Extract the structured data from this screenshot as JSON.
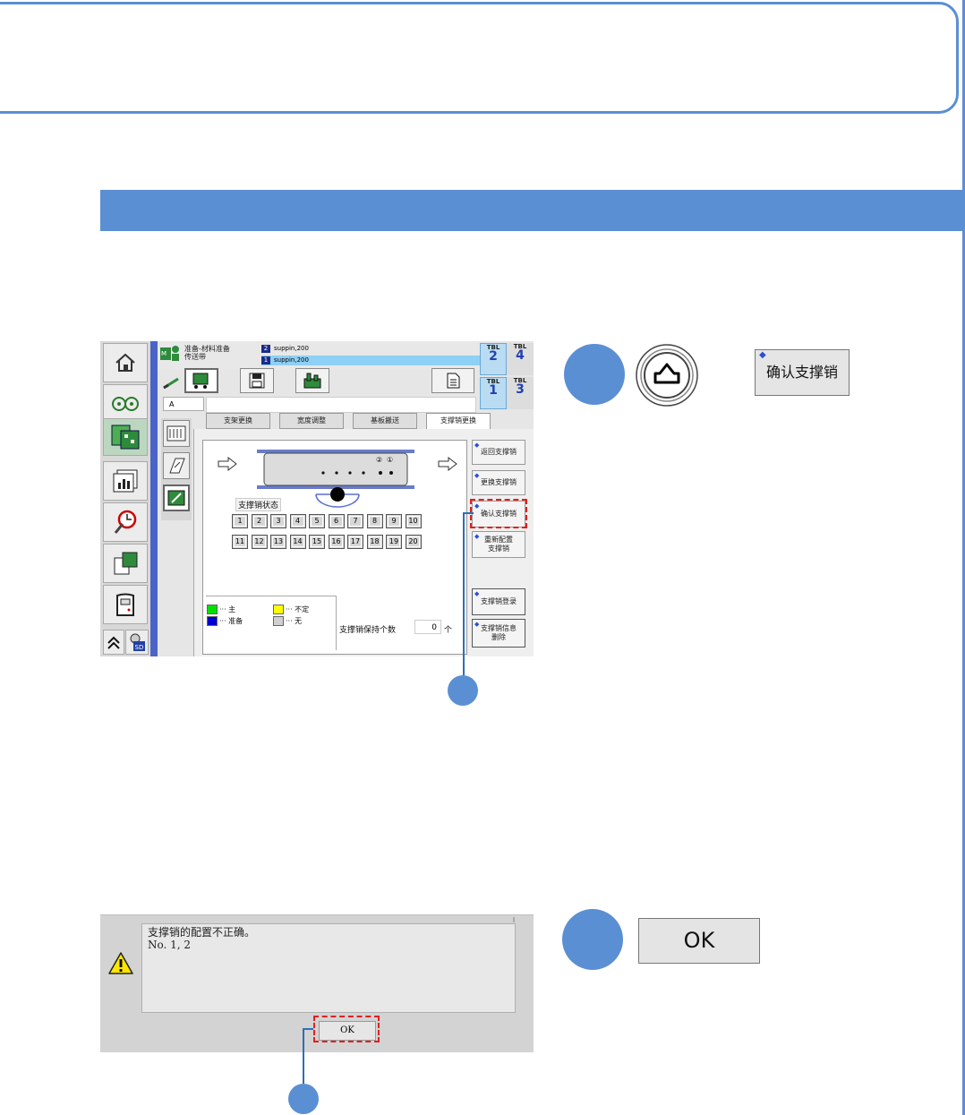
{
  "screen1": {
    "status_line1": "准备-材料准备",
    "status_line2": "传送带",
    "materials": [
      {
        "num": "2",
        "name": "suppin,200"
      },
      {
        "num": "1",
        "name": "suppin,200"
      }
    ],
    "tbl_label": "TBL",
    "tbl_numbers": [
      "2",
      "4",
      "1",
      "3"
    ],
    "lane_label": "A",
    "tabs": [
      "支架更换",
      "宽度调整",
      "基板搬送",
      "支撑销更换"
    ],
    "pin_status_title": "支撑销状态",
    "pins_row1": [
      "1",
      "2",
      "3",
      "4",
      "5",
      "6",
      "7",
      "8",
      "9",
      "10"
    ],
    "pins_row2": [
      "11",
      "12",
      "13",
      "14",
      "15",
      "16",
      "17",
      "18",
      "19",
      "20"
    ],
    "board_marks": [
      "②",
      "①"
    ],
    "legend": [
      {
        "color": "#00e000",
        "label": "··· 主"
      },
      {
        "color": "#ffff00",
        "label": "··· 不定"
      },
      {
        "color": "#0000d0",
        "label": "··· 准备"
      },
      {
        "color": "#d0d0d0",
        "label": "··· 无"
      }
    ],
    "hold_label": "支撑销保持个数",
    "hold_value": "0",
    "hold_unit": "个",
    "right_buttons": [
      "返回支撑销",
      "更换支撑销",
      "确认支撑销",
      "重新配置\n支撑销",
      "支撑销登录",
      "支撑销信息\n删除"
    ]
  },
  "step_button_label": "确认支撑销",
  "ok_big_label": "OK",
  "screen2": {
    "message_line1": "支撑销的配置不正确。",
    "message_line2": "No. 1, 2",
    "ok_label": "OK"
  }
}
